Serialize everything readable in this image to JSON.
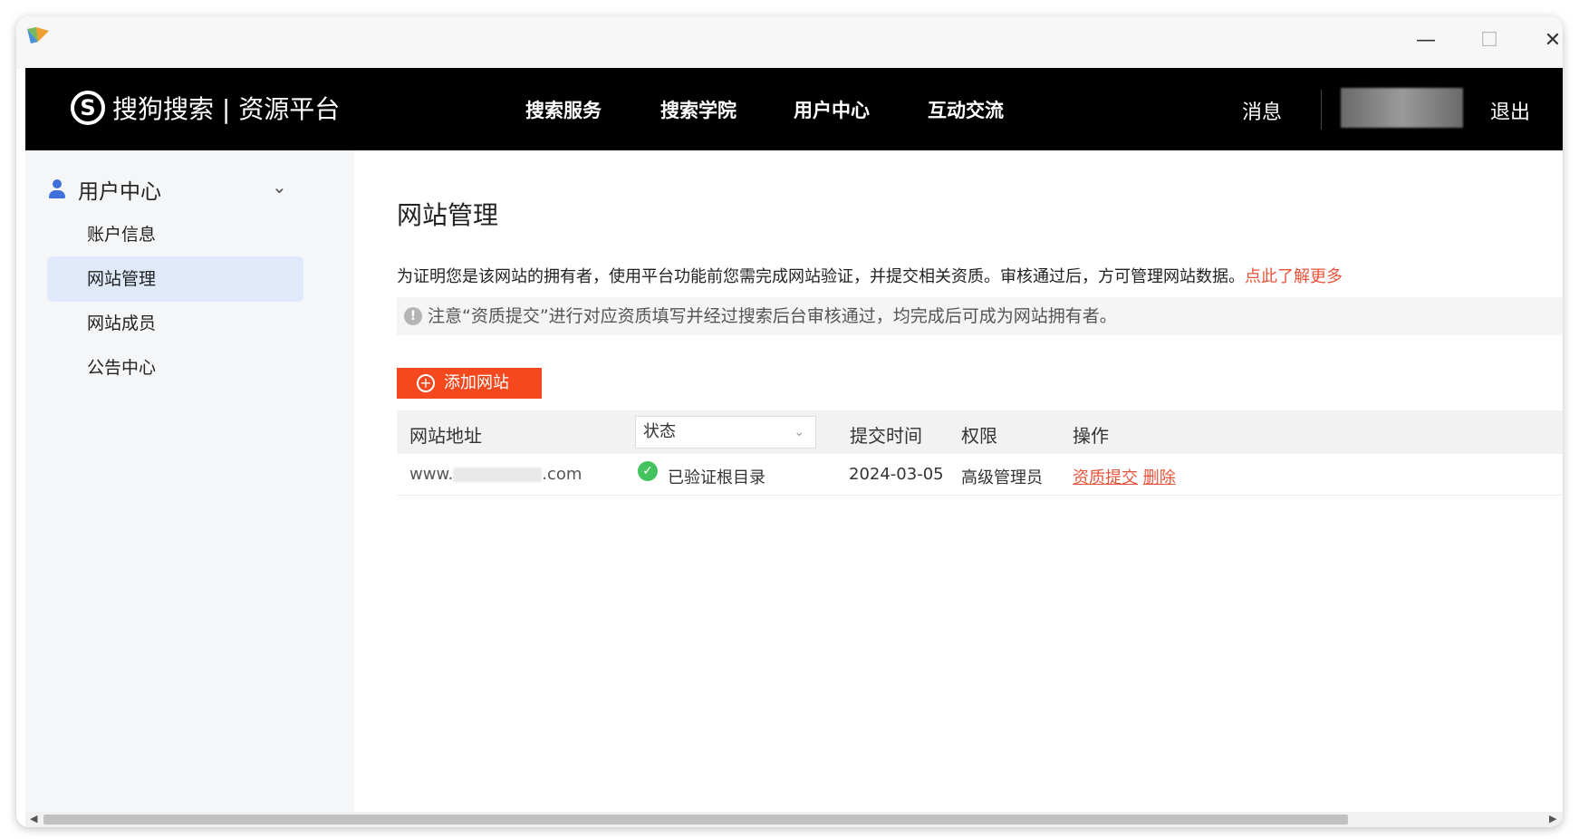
{
  "window": {
    "minimize": "—",
    "maximize": "☐",
    "close": "✕"
  },
  "header": {
    "logo_mark": "S",
    "logo_text": "搜狗搜索 | 资源平台",
    "nav": [
      "搜索服务",
      "搜索学院",
      "用户中心",
      "互动交流"
    ],
    "messages": "消息",
    "logout": "退出"
  },
  "sidebar": {
    "section": "用户中心",
    "items": [
      {
        "label": "账户信息"
      },
      {
        "label": "网站管理"
      },
      {
        "label": "网站成员"
      },
      {
        "label": "公告中心"
      }
    ]
  },
  "main": {
    "title": "网站管理",
    "intro": "为证明您是该网站的拥有者，使用平台功能前您需完成网站验证，并提交相关资质。审核通过后，方可管理网站数据。",
    "learn_more": "点此了解更多",
    "notice": "注意“资质提交”进行对应资质填写并经过搜索后台审核通过，均完成后可成为网站拥有者。",
    "add_button": "添加网站",
    "table": {
      "headers": {
        "url": "网站地址",
        "status": "状态",
        "time": "提交时间",
        "permission": "权限",
        "ops": "操作"
      },
      "rows": [
        {
          "url_prefix": "www.",
          "url_suffix": ".com",
          "status": "已验证根目录",
          "time": "2024-03-05",
          "permission": "高级管理员",
          "op1": "资质提交",
          "op2": "删除"
        }
      ]
    }
  },
  "colors": {
    "accent": "#f5481e",
    "link": "#e8543a",
    "nav_bg": "#000000",
    "sidebar_active": "#dfe9f9",
    "success": "#44c25e"
  }
}
